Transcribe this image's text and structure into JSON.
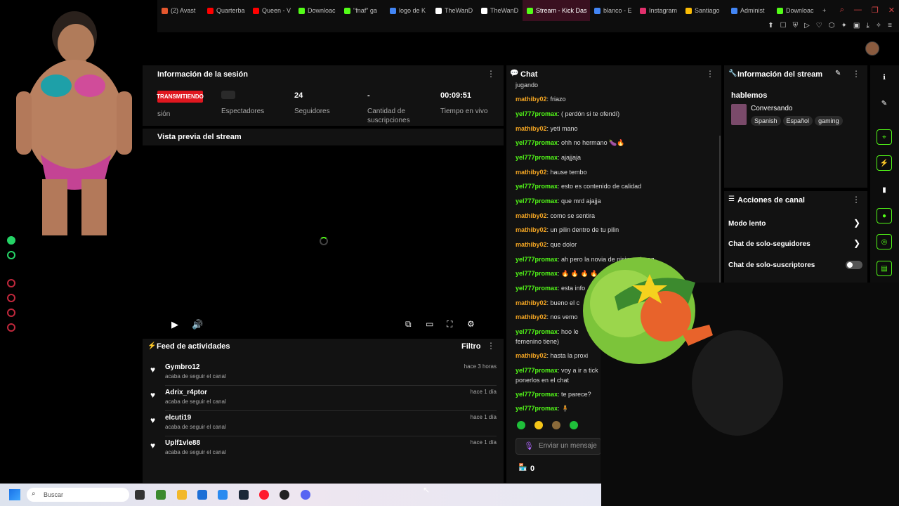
{
  "browser": {
    "tabs": [
      {
        "label": "(2) Avast",
        "color": "#e4572e"
      },
      {
        "label": "Quarterba",
        "color": "#ff0000"
      },
      {
        "label": "Queen - V",
        "color": "#ff0000"
      },
      {
        "label": "Downloac",
        "color": "#53fc18"
      },
      {
        "label": "\"fnaf\" ga",
        "color": "#53fc18"
      },
      {
        "label": "logo de K",
        "color": "#4285f4"
      },
      {
        "label": "TheWanD",
        "color": "#ffffff"
      },
      {
        "label": "TheWanD",
        "color": "#ffffff"
      },
      {
        "label": "Stream - Kick Das",
        "color": "#53fc18",
        "active": true
      },
      {
        "label": "blanco - E",
        "color": "#4285f4"
      },
      {
        "label": "Instagram",
        "color": "#e1306c"
      },
      {
        "label": "Santiago",
        "color": "#fbbc05"
      },
      {
        "label": "Administ",
        "color": "#4285f4"
      },
      {
        "label": "Downloac",
        "color": "#53fc18"
      }
    ],
    "new_tab": "+"
  },
  "session": {
    "title": "Información de la sesión",
    "status_badge": "TRANSMITIENDO",
    "status_label": "sión",
    "stats": [
      {
        "value": "",
        "label": "Espectadores"
      },
      {
        "value": "24",
        "label": "Seguidores"
      },
      {
        "value": "-",
        "label": "Cantidad de suscripciones"
      },
      {
        "value": "00:09:51",
        "label": "Tiempo en vivo"
      }
    ]
  },
  "preview": {
    "title": "Vista previa del stream"
  },
  "feed": {
    "title": "Feed de actividades",
    "filter": "Filtro",
    "items": [
      {
        "name": "Gymbro12",
        "desc": "acaba de seguir el canal",
        "time": "hace 3 horas"
      },
      {
        "name": "Adrix_r4ptor",
        "desc": "acaba de seguir el canal",
        "time": "hace 1 día"
      },
      {
        "name": "elcuti19",
        "desc": "acaba de seguir el canal",
        "time": "hace 1 día"
      },
      {
        "name": "Uplf1vle88",
        "desc": "acaba de seguir el canal",
        "time": "hace 1 día"
      }
    ]
  },
  "chat": {
    "title": "Chat",
    "messages": [
      {
        "user": "",
        "text": "jugando"
      },
      {
        "user": "mathiby02",
        "text": ": friazo"
      },
      {
        "user": "yel777promax",
        "text": ": ( perdón si te ofendí)"
      },
      {
        "user": "mathiby02",
        "text": ": yeti mano"
      },
      {
        "user": "yel777promax",
        "text": ": ohh no hermano 🍆🔥"
      },
      {
        "user": "yel777promax",
        "text": ": ajajjaja"
      },
      {
        "user": "mathiby02",
        "text": ": hause tembo"
      },
      {
        "user": "yel777promax",
        "text": ": esto es contenido de calidad"
      },
      {
        "user": "yel777promax",
        "text": ": que mrd ajajja"
      },
      {
        "user": "mathiby02",
        "text": ": como se sentira"
      },
      {
        "user": "mathiby02",
        "text": ": un pilin dentro de tu pilin"
      },
      {
        "user": "mathiby02",
        "text": ": que dolor"
      },
      {
        "user": "yel777promax",
        "text": ": ah pero la novia de                 nisima ahggg"
      },
      {
        "user": "yel777promax",
        "text": ": 🔥 🔥 🔥 🔥"
      },
      {
        "user": "yel777promax",
        "text": ": esta info"
      },
      {
        "user": "mathiby02",
        "text": ": bueno el c"
      },
      {
        "user": "mathiby02",
        "text": ": nos vemo"
      },
      {
        "user": "yel777promax",
        "text": ": hoo le"
      },
      {
        "user": "",
        "text": "femenino tiene)"
      },
      {
        "user": "mathiby02",
        "text": ": hasta la proxi"
      },
      {
        "user": "yel777promax",
        "text": ": voy a ir a tick"
      },
      {
        "user": "",
        "text": "ponerlos en el chat"
      },
      {
        "user": "yel777promax",
        "text": ": te parece?"
      },
      {
        "user": "yel777promax",
        "text": ": 🧍"
      }
    ],
    "input_placeholder": "Enviar un mensaje",
    "points": "0"
  },
  "stream_info": {
    "title": "Información del stream",
    "stream_title": "hablemos",
    "category": "Conversando",
    "tags": [
      "Spanish",
      "Español",
      "gaming"
    ]
  },
  "channel_actions": {
    "title": "Acciones de canal",
    "items": [
      "Modo lento",
      "Chat de solo-seguidores",
      "Chat de solo-suscriptores"
    ]
  },
  "taskbar": {
    "search_placeholder": "Buscar"
  }
}
